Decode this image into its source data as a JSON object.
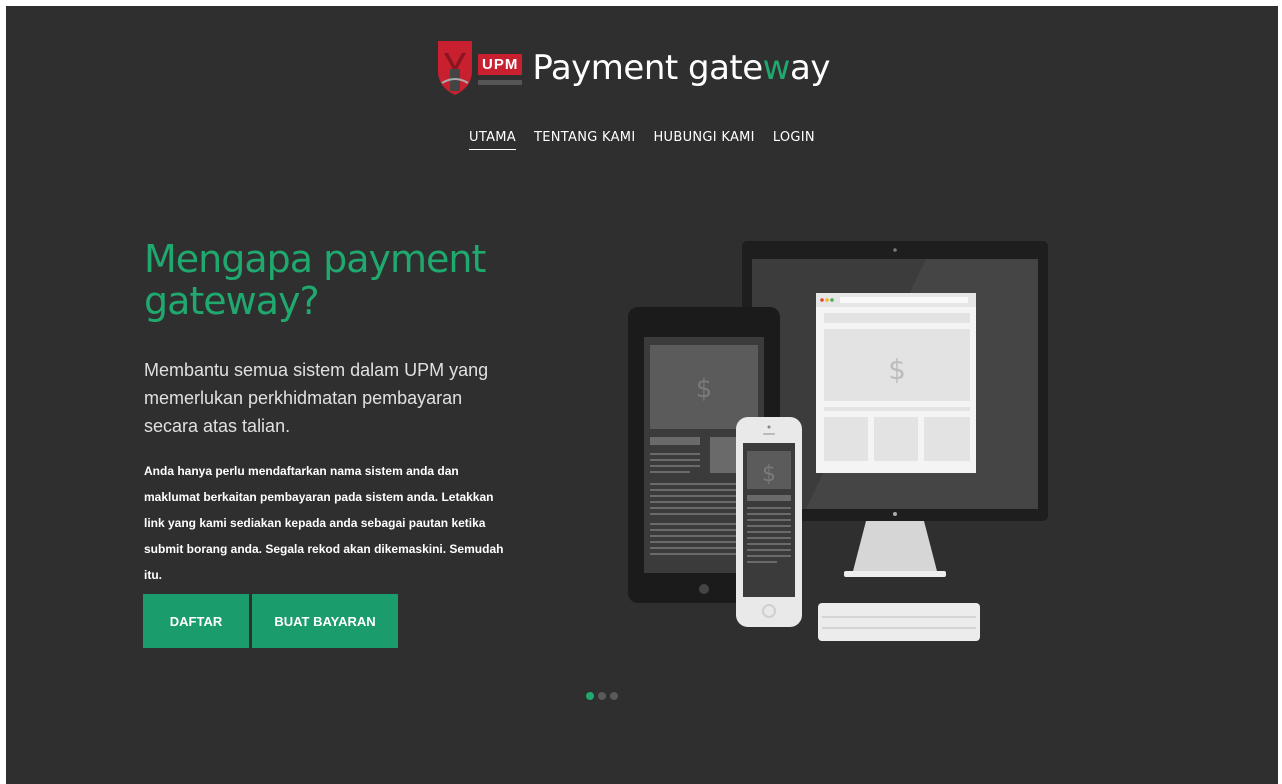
{
  "brand": {
    "badge": "UPM",
    "title_main": "Payment gate",
    "title_accent": "w",
    "title_tail": "ay"
  },
  "nav": {
    "items": [
      {
        "label": "UTAMA",
        "active": true
      },
      {
        "label": "TENTANG KAMI",
        "active": false
      },
      {
        "label": "HUBUNGI KAMI",
        "active": false
      },
      {
        "label": "LOGIN",
        "active": false
      }
    ]
  },
  "hero": {
    "headline": "Mengapa payment gateway?",
    "lead": "Membantu semua sistem dalam UPM yang memerlukan perkhidmatan pembayaran secara atas talian.",
    "body": "Anda hanya perlu mendaftarkan nama sistem anda dan maklumat berkaitan pembayaran pada sistem anda. Letakkan link yang kami sediakan kepada anda sebagai pautan ketika submit borang anda. Segala rekod akan dikemaskini. Semudah itu.",
    "buttons": {
      "register": "DAFTAR",
      "pay": "BUAT BAYARAN"
    },
    "illustration_glyph": "$"
  },
  "carousel": {
    "slides": 3,
    "active_index": 0
  },
  "colors": {
    "background": "#2f2f2f",
    "accent": "#1fa96e",
    "button": "#1a9c6c",
    "badge": "#c8202f"
  }
}
